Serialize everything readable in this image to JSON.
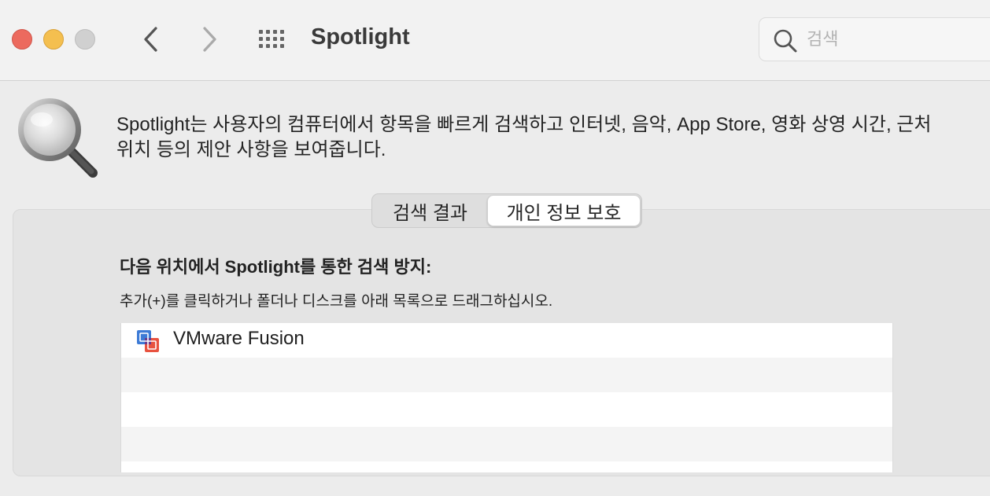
{
  "window": {
    "title": "Spotlight",
    "search_placeholder": "검색"
  },
  "icons": {
    "close": "close-button",
    "minimize": "minimize-button",
    "zoom": "zoom-button",
    "back": "chevron-left-icon",
    "forward": "chevron-right-icon",
    "all_prefs": "grid-icon",
    "search": "magnifier-icon",
    "spotlight": "spotlight-magnifier-icon",
    "vmware": "vmware-fusion-icon"
  },
  "header": {
    "description_line1": "Spotlight는 사용자의 컴퓨터에서 항목을 빠르게 검색하고 인터넷, 음악, App Store, 영화 상영 시간, 근처",
    "description_line2": "위치 등의 제안 사항을 보여줍니다."
  },
  "tabs": [
    {
      "label": "검색 결과",
      "selected": false
    },
    {
      "label": "개인 정보 보호",
      "selected": true
    }
  ],
  "privacy": {
    "heading": "다음 위치에서 Spotlight를 통한 검색 방지:",
    "instructions": "추가(+)를 클릭하거나 폴더나 디스크를 아래 목록으로 드래그하십시오.",
    "items": [
      {
        "label": "VMware Fusion"
      }
    ]
  },
  "colors": {
    "close": "#ec6a5e",
    "minimize": "#f4bf4f",
    "zoom_disabled": "#d0d0d0"
  }
}
